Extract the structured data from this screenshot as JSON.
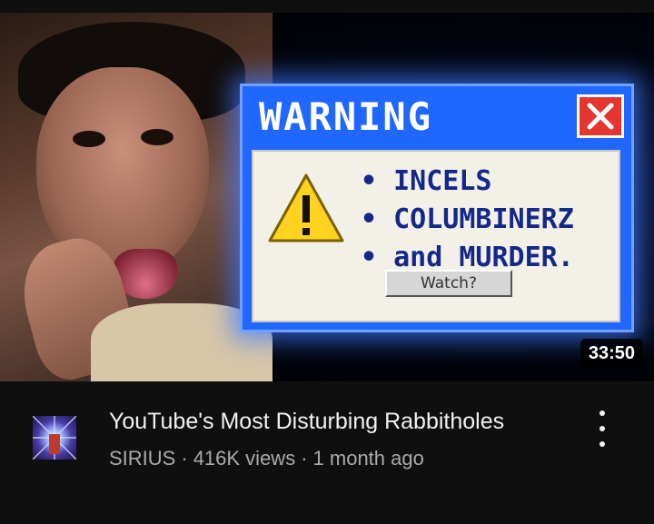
{
  "thumbnail": {
    "dialog_title": "WARNING",
    "bullets": [
      "INCELS",
      "COLUMBINERZ",
      "and MURDER."
    ],
    "watch_button": "Watch?",
    "duration": "33:50"
  },
  "video": {
    "title": "YouTube's Most Disturbing Rabbitholes",
    "channel": "SIRIUS",
    "views": "416K views",
    "age": "1 month ago",
    "separator": "·"
  },
  "colors": {
    "background": "#0f0f0f",
    "dialog_blue": "#1f67ff",
    "close_red": "#e4352e",
    "warning_yellow": "#ffd21f"
  },
  "icons": [
    "close-icon",
    "warning-icon",
    "more-options-icon",
    "channel-avatar"
  ]
}
